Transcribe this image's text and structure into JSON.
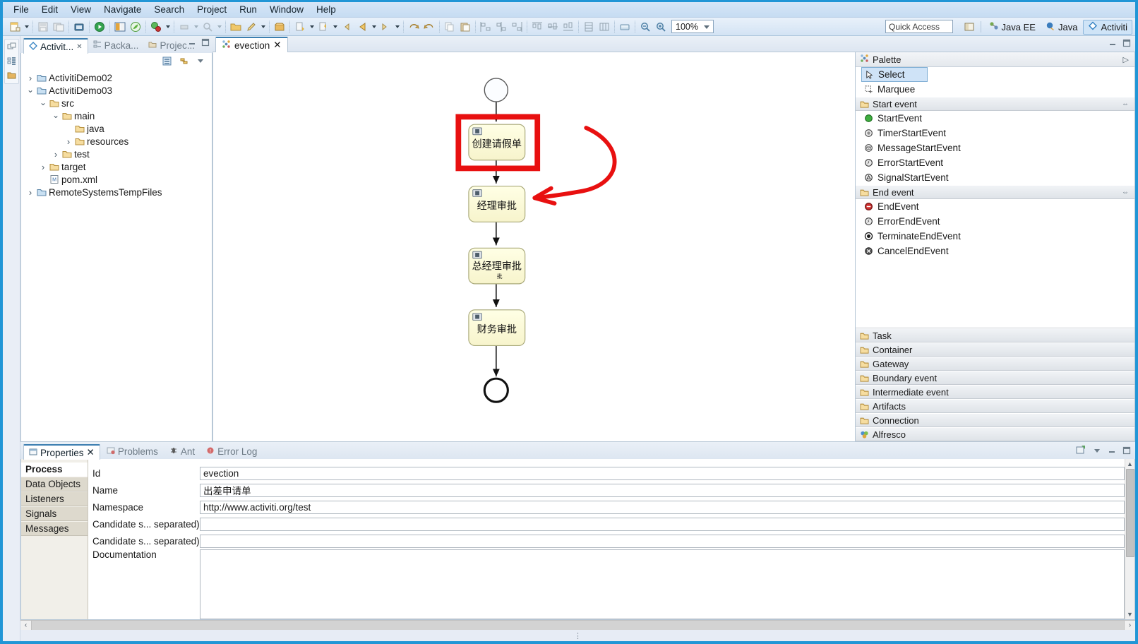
{
  "menubar": {
    "items": [
      "File",
      "Edit",
      "View",
      "Navigate",
      "Search",
      "Project",
      "Run",
      "Window",
      "Help"
    ]
  },
  "toolbar": {
    "zoom_level": "100%",
    "quick_access_placeholder": "Quick Access",
    "perspectives": [
      {
        "label": "Java EE",
        "active": false
      },
      {
        "label": "Java",
        "active": false
      },
      {
        "label": "Activiti",
        "active": true
      }
    ]
  },
  "explorer": {
    "tabs": [
      {
        "label": "Activit...",
        "active": true
      },
      {
        "label": "Packa...",
        "active": false
      },
      {
        "label": "Projec...",
        "active": false
      }
    ],
    "tree": [
      {
        "label": "ActivitiDemo02",
        "indent": 0,
        "twist": "collapsed",
        "icon": "project-icon"
      },
      {
        "label": "ActivitiDemo03",
        "indent": 0,
        "twist": "expanded",
        "icon": "project-icon"
      },
      {
        "label": "src",
        "indent": 1,
        "twist": "expanded",
        "icon": "folder-icon"
      },
      {
        "label": "main",
        "indent": 2,
        "twist": "expanded",
        "icon": "folder-icon"
      },
      {
        "label": "java",
        "indent": 3,
        "twist": "none",
        "icon": "folder-icon"
      },
      {
        "label": "resources",
        "indent": 3,
        "twist": "collapsed",
        "icon": "folder-icon"
      },
      {
        "label": "test",
        "indent": 2,
        "twist": "collapsed",
        "icon": "folder-icon"
      },
      {
        "label": "target",
        "indent": 1,
        "twist": "collapsed",
        "icon": "folder-icon"
      },
      {
        "label": "pom.xml",
        "indent": 1,
        "twist": "none",
        "icon": "xml-file-icon"
      },
      {
        "label": "RemoteSystemsTempFiles",
        "indent": 0,
        "twist": "collapsed",
        "icon": "project-icon"
      }
    ]
  },
  "editor": {
    "tab_label": "evection"
  },
  "diagram": {
    "start_event": {
      "name": "",
      "shape": "circle"
    },
    "end_event": {
      "name": "",
      "shape": "circle-thick"
    },
    "tasks": [
      {
        "label": "创建请假单",
        "highlighted": true
      },
      {
        "label": "经理审批",
        "highlighted": false
      },
      {
        "label": "总经理审批",
        "highlighted": false
      },
      {
        "label": "财务审批",
        "highlighted": false
      }
    ],
    "annotation": {
      "color": "#e81010",
      "shape": "rectangle-and-curved-arrow"
    }
  },
  "palette": {
    "title": "Palette",
    "tools": [
      {
        "label": "Select",
        "icon": "cursor-icon",
        "selected": true
      },
      {
        "label": "Marquee",
        "icon": "marquee-icon",
        "selected": false
      }
    ],
    "sections": [
      {
        "title": "Start event",
        "expanded": true,
        "items": [
          {
            "label": "StartEvent",
            "icon": "green-circle-icon"
          },
          {
            "label": "TimerStartEvent",
            "icon": "timer-icon"
          },
          {
            "label": "MessageStartEvent",
            "icon": "envelope-icon"
          },
          {
            "label": "ErrorStartEvent",
            "icon": "error-bolt-icon"
          },
          {
            "label": "SignalStartEvent",
            "icon": "signal-icon"
          }
        ]
      },
      {
        "title": "End event",
        "expanded": true,
        "items": [
          {
            "label": "EndEvent",
            "icon": "red-circle-icon"
          },
          {
            "label": "ErrorEndEvent",
            "icon": "error-bolt-icon"
          },
          {
            "label": "TerminateEndEvent",
            "icon": "terminate-icon"
          },
          {
            "label": "CancelEndEvent",
            "icon": "cancel-icon"
          }
        ]
      }
    ],
    "collapsed_sections": [
      {
        "title": "Task",
        "icon": "folder-icon"
      },
      {
        "title": "Container",
        "icon": "folder-icon"
      },
      {
        "title": "Gateway",
        "icon": "folder-icon"
      },
      {
        "title": "Boundary event",
        "icon": "folder-icon"
      },
      {
        "title": "Intermediate event",
        "icon": "folder-icon"
      },
      {
        "title": "Artifacts",
        "icon": "folder-icon"
      },
      {
        "title": "Connection",
        "icon": "folder-icon"
      },
      {
        "title": "Alfresco",
        "icon": "alfresco-icon"
      }
    ]
  },
  "properties": {
    "tabs": [
      {
        "label": "Properties",
        "active": true,
        "icon": "properties-icon"
      },
      {
        "label": "Problems",
        "active": false,
        "icon": "problems-icon"
      },
      {
        "label": "Ant",
        "active": false,
        "icon": "ant-icon"
      },
      {
        "label": "Error Log",
        "active": false,
        "icon": "error-log-icon"
      }
    ],
    "sidebar": [
      {
        "label": "Process",
        "active": true
      },
      {
        "label": "Data Objects",
        "active": false
      },
      {
        "label": "Listeners",
        "active": false
      },
      {
        "label": "Signals",
        "active": false
      },
      {
        "label": "Messages",
        "active": false
      }
    ],
    "fields": [
      {
        "label": "Id",
        "value": "evection",
        "type": "text"
      },
      {
        "label": "Name",
        "value": "出差申请单",
        "type": "text"
      },
      {
        "label": "Namespace",
        "value": "http://www.activiti.org/test",
        "type": "text"
      },
      {
        "label": "Candidate s... separated)",
        "value": "",
        "type": "text"
      },
      {
        "label": "Candidate s... separated)",
        "value": "",
        "type": "text"
      },
      {
        "label": "Documentation",
        "value": "",
        "type": "textarea"
      }
    ]
  },
  "colors": {
    "accent": "#2196d6",
    "task_fill": "#ffffcc",
    "task_border": "#a9a97a",
    "annotation_red": "#e81010",
    "selection_blue": "#cfe3f7"
  }
}
